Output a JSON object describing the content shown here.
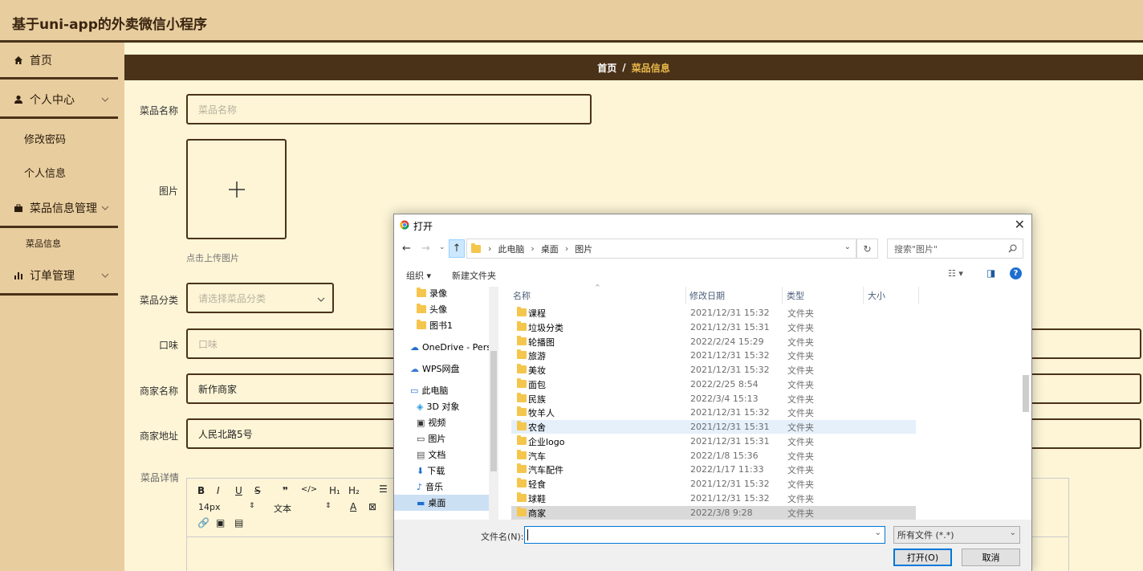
{
  "app": {
    "title": "基于uni-app的外卖微信小程序"
  },
  "sidebar": {
    "items": [
      {
        "label": "首页",
        "icon": "home-icon"
      },
      {
        "label": "个人中心",
        "icon": "user-icon"
      },
      {
        "label": "修改密码"
      },
      {
        "label": "个人信息"
      },
      {
        "label": "菜品信息管理",
        "icon": "briefcase-icon"
      },
      {
        "label": "菜品信息"
      },
      {
        "label": "订单管理",
        "icon": "bar-chart-icon"
      }
    ]
  },
  "breadcrumb": {
    "home": "首页",
    "separator": "/",
    "current": "菜品信息"
  },
  "form": {
    "name_label": "菜品名称",
    "name_placeholder": "菜品名称",
    "image_label": "图片",
    "upload_hint": "点击上传图片",
    "category_label": "菜品分类",
    "category_placeholder": "请选择菜品分类",
    "taste_label": "口味",
    "taste_placeholder": "口味",
    "shop_name_label": "商家名称",
    "shop_name_value": "新作商家",
    "shop_addr_label": "商家地址",
    "shop_addr_value": "人民北路5号",
    "detail_label": "菜品详情"
  },
  "editor": {
    "bold": "B",
    "italic": "I",
    "underline": "U",
    "strike": "S",
    "quote": "❞",
    "code": "</>",
    "h1": "H₁",
    "h2": "H₂",
    "font_size": "14px",
    "text_style": "文本"
  },
  "dialog": {
    "title": "打开",
    "path": [
      "此电脑",
      "桌面",
      "图片"
    ],
    "search_placeholder": "搜索\"图片\"",
    "organize": "组织 ▾",
    "new_folder": "新建文件夹",
    "columns": {
      "name": "名称",
      "date": "修改日期",
      "type": "类型",
      "size": "大小"
    },
    "tree": [
      {
        "label": "录像",
        "icon": "folder-icon"
      },
      {
        "label": "头像",
        "icon": "folder-icon"
      },
      {
        "label": "图书1",
        "icon": "folder-icon"
      },
      {
        "label": "OneDrive - Perso",
        "icon": "cloud-icon"
      },
      {
        "label": "WPS网盘",
        "icon": "cloud-icon"
      },
      {
        "label": "此电脑",
        "icon": "computer-icon"
      },
      {
        "label": "3D 对象",
        "icon": "cube-icon"
      },
      {
        "label": "视频",
        "icon": "video-icon"
      },
      {
        "label": "图片",
        "icon": "image-icon"
      },
      {
        "label": "文档",
        "icon": "document-icon"
      },
      {
        "label": "下载",
        "icon": "download-icon"
      },
      {
        "label": "音乐",
        "icon": "music-icon"
      },
      {
        "label": "桌面",
        "icon": "desktop-icon"
      }
    ],
    "files": [
      {
        "name": "课程",
        "date": "2021/12/31 15:32",
        "type": "文件夹"
      },
      {
        "name": "垃圾分类",
        "date": "2021/12/31 15:31",
        "type": "文件夹"
      },
      {
        "name": "轮播图",
        "date": "2022/2/24 15:29",
        "type": "文件夹"
      },
      {
        "name": "旅游",
        "date": "2021/12/31 15:32",
        "type": "文件夹"
      },
      {
        "name": "美妆",
        "date": "2021/12/31 15:32",
        "type": "文件夹"
      },
      {
        "name": "面包",
        "date": "2022/2/25 8:54",
        "type": "文件夹"
      },
      {
        "name": "民族",
        "date": "2022/3/4 15:13",
        "type": "文件夹"
      },
      {
        "name": "牧羊人",
        "date": "2021/12/31 15:32",
        "type": "文件夹"
      },
      {
        "name": "农舍",
        "date": "2021/12/31 15:31",
        "type": "文件夹"
      },
      {
        "name": "企业logo",
        "date": "2021/12/31 15:31",
        "type": "文件夹"
      },
      {
        "name": "汽车",
        "date": "2022/1/8 15:36",
        "type": "文件夹"
      },
      {
        "name": "汽车配件",
        "date": "2022/1/17 11:33",
        "type": "文件夹"
      },
      {
        "name": "轻食",
        "date": "2021/12/31 15:32",
        "type": "文件夹"
      },
      {
        "name": "球鞋",
        "date": "2021/12/31 15:32",
        "type": "文件夹"
      },
      {
        "name": "商家",
        "date": "2022/3/8 9:28",
        "type": "文件夹"
      }
    ],
    "filename_label": "文件名(N):",
    "filename_value": "",
    "filetype": "所有文件 (*.*)",
    "open_button": "打开(O)",
    "cancel_button": "取消"
  },
  "colors": {
    "header_bg": "#e8cd9f",
    "dark_brown": "#4a3219",
    "content_bg": "#fdf5d6",
    "accent": "#e8b84a"
  }
}
